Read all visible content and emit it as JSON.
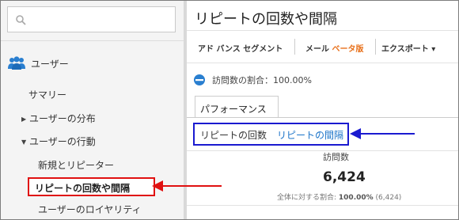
{
  "sidebar": {
    "search": {
      "placeholder": "",
      "value": ""
    },
    "section_label": "ユーザー",
    "items": [
      {
        "label": "サマリー",
        "arrow": ""
      },
      {
        "label": "ユーザーの分布",
        "arrow": "▶"
      },
      {
        "label": "ユーザーの行動",
        "arrow": "▼"
      },
      {
        "label": "新規とリピーター",
        "arrow": ""
      },
      {
        "label": "リピートの回数や間隔",
        "arrow": ""
      },
      {
        "label": "ユーザーのロイヤリティ",
        "arrow": ""
      }
    ]
  },
  "main": {
    "title": "リピートの回数や間隔",
    "toolbar": {
      "advanced_segment": "アド バンス セグメント",
      "mail": "メール",
      "beta": "ベータ版",
      "export": "エクスポート",
      "export_caret": "▾"
    },
    "percentage_text": "訪問数の割合：100.00%",
    "tab_label": "パフォーマンス",
    "subtabs": [
      {
        "label": "リピートの回数"
      },
      {
        "label": "リピートの間隔"
      }
    ],
    "metric": {
      "label": "訪問数",
      "value": "6,424",
      "share_prefix": "全体に対する割合: ",
      "share_percent": "100.00%",
      "share_total": " (6,424)"
    }
  },
  "colors": {
    "highlight_red": "#e01010",
    "highlight_blue": "#1a1ad0",
    "link_blue": "#1a73c8",
    "beta_orange": "#e8701a",
    "users_icon_blue": "#2a7fd0"
  },
  "icons": {
    "search": "search-icon",
    "users": "users-icon",
    "pie": "pie-icon",
    "red_arrow": "arrow-left-icon",
    "blue_arrow": "arrow-left-icon"
  }
}
